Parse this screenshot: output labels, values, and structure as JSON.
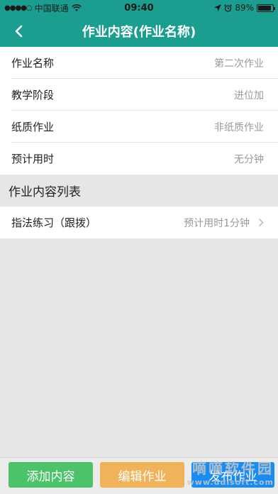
{
  "status_bar": {
    "carrier": "中国联通",
    "time": "09:40",
    "battery": "89%",
    "battery_level": 0.89,
    "icons": [
      "signal-dots-icon",
      "wifi-icon",
      "location-arrow-icon",
      "alarm-icon",
      "battery-icon"
    ]
  },
  "nav": {
    "title": "作业内容(作业名称)",
    "back_icon": "chevron-left-icon"
  },
  "form": {
    "rows": [
      {
        "label": "作业名称",
        "value": "第二次作业"
      },
      {
        "label": "教学阶段",
        "value": "进位加"
      },
      {
        "label": "纸质作业",
        "value": "非纸质作业"
      },
      {
        "label": "预计用时",
        "value": "无分钟"
      }
    ]
  },
  "section": {
    "title": "作业内容列表"
  },
  "list": {
    "items": [
      {
        "label": "指法练习（跟拨）",
        "value": "预计用时1分钟",
        "icon": "chevron-right-icon"
      }
    ]
  },
  "actions": {
    "add_label": "添加内容",
    "edit_label": "编辑作业",
    "publish_label": "发布作业"
  },
  "watermark": {
    "text": "嘀嘀软件园",
    "url": "www.ddisoft.com"
  },
  "colors": {
    "header": "#1b9e8f",
    "add_button": "#4cc26a",
    "edit_button": "#f0b35a",
    "publish_button": "#1a8bf0"
  }
}
